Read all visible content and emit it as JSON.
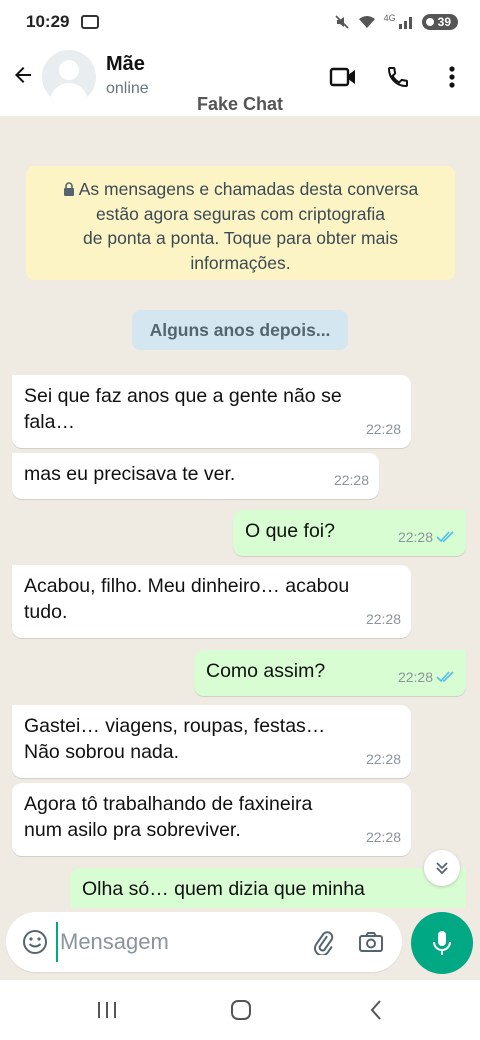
{
  "status_bar": {
    "time": "10:29",
    "battery": "39",
    "network": "4G"
  },
  "header": {
    "contact_name": "Mãe",
    "contact_status": "online",
    "watermark": "Fake Chat"
  },
  "chat": {
    "encryption_notice_lines": [
      "As mensagens e chamadas desta conversa",
      "estão agora seguras com criptografia",
      "de ponta a ponta. Toque para obter mais",
      "informações."
    ],
    "date_chip": "Alguns anos depois...",
    "messages": [
      {
        "direction": "in",
        "lines": [
          "Sei que faz anos que a gente não se",
          "fala…"
        ],
        "time": "22:28"
      },
      {
        "direction": "in",
        "lines": [
          "mas eu precisava te ver."
        ],
        "time": "22:28"
      },
      {
        "direction": "out",
        "lines": [
          "O que foi?"
        ],
        "time": "22:28"
      },
      {
        "direction": "in",
        "lines": [
          "Acabou, filho. Meu dinheiro… acabou",
          "tudo."
        ],
        "time": "22:28"
      },
      {
        "direction": "out",
        "lines": [
          "Como assim?"
        ],
        "time": "22:28"
      },
      {
        "direction": "in",
        "lines": [
          "Gastei… viagens, roupas, festas…",
          "Não sobrou nada."
        ],
        "time": "22:28"
      },
      {
        "direction": "in",
        "lines": [
          "Agora tô trabalhando de faxineira",
          "num asilo pra sobreviver."
        ],
        "time": "22:28"
      },
      {
        "direction": "out",
        "lines": [
          "Olha só… quem dizia que minha"
        ],
        "time": ""
      }
    ]
  },
  "input": {
    "placeholder": "Mensagem"
  },
  "colors": {
    "accent": "#00a884",
    "chat_background": "#efeae2",
    "outgoing_bubble": "#d9fdd3",
    "incoming_bubble": "#ffffff",
    "encryption_notice": "#fdf4c5",
    "date_chip": "#d4e7f1",
    "read_ticks": "#53bdeb"
  },
  "icons": {
    "back": "arrow-left-icon",
    "video": "video-camera-icon",
    "call": "phone-icon",
    "menu": "kebab-menu-icon",
    "lock": "lock-icon",
    "read": "double-check-icon",
    "scroll_down": "chevron-double-down-icon",
    "emoji": "emoji-icon",
    "attach": "paperclip-icon",
    "camera": "camera-icon",
    "mic": "microphone-icon"
  }
}
